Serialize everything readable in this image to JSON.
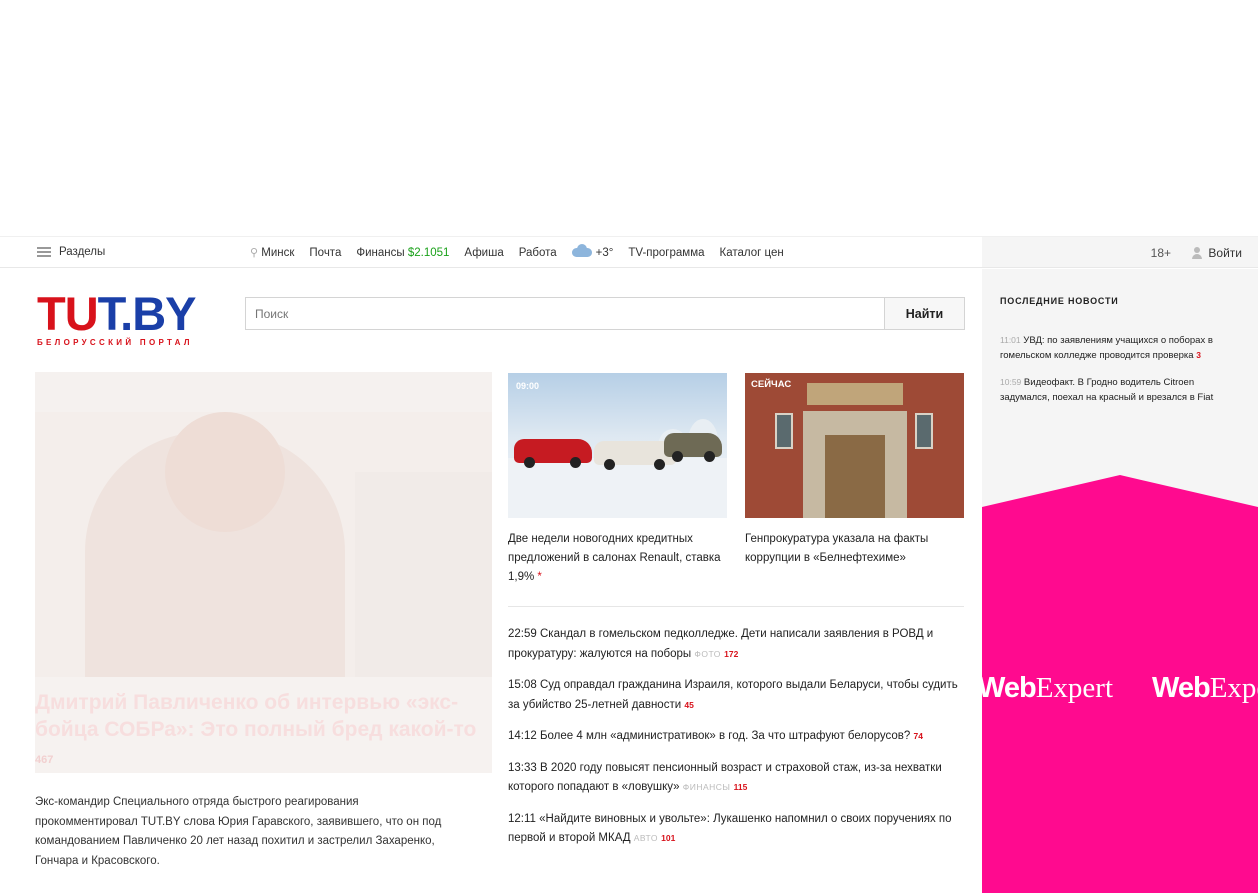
{
  "topnav": {
    "sections_label": "Разделы",
    "city": "Минск",
    "mail": "Почта",
    "finance_label": "Финансы",
    "finance_value": "$2.1051",
    "afisha": "Афиша",
    "jobs": "Работа",
    "weather": "+3°",
    "tv": "TV-программа",
    "catalog": "Каталог цен",
    "age": "18+",
    "login": "Войти"
  },
  "logo": {
    "part1": "T",
    "part2": "U",
    "part3": "T.BY",
    "tagline": "БЕЛОРУССКИЙ ПОРТАЛ"
  },
  "search": {
    "placeholder": "Поиск",
    "button": "Найти"
  },
  "main_story": {
    "title": "Дмитрий Павличенко об интервью «экс-бойца СОБРа»: Это полный бред какой-то",
    "count": "467",
    "lead": "Экс-командир Специального отряда быстрого реагирования прокомментировал TUT.BY слова Юрия Гаравского, заявившего, что он под командованием Павличенко 20 лет назад похитил и застрелил Захаренко, Гончара и Красовского."
  },
  "cards": [
    {
      "badge": "09:00",
      "caption": "Две недели новогодних кредитных предложений в салонах Renault, ставка 1,9%",
      "mark": "*"
    },
    {
      "badge": "СЕЙЧАС",
      "caption": "Генпрокуратура указала на факты коррупции в «Белнефтехиме»"
    }
  ],
  "news": [
    {
      "time": "22:59",
      "text": "Скандал в гомельском педколледже. Дети написали заявления в РОВД и прокуратуру: жалуются на поборы",
      "tag": "ФОТО",
      "count": "172"
    },
    {
      "time": "15:08",
      "text": "Суд оправдал гражданина Израиля, которого выдали Беларуси, чтобы судить за убийство 25-летней давности",
      "tag": "",
      "count": "45"
    },
    {
      "time": "14:12",
      "text": "Более 4 млн «административок» в год. За что штрафуют белорусов?",
      "tag": "",
      "count": "74"
    },
    {
      "time": "13:33",
      "text": "В 2020 году повысят пенсионный возраст и страховой стаж, из-за нехватки которого попадают в «ловушку»",
      "tag": "ФИНАНСЫ",
      "count": "115"
    },
    {
      "time": "12:11",
      "text": "«Найдите виновных и увольте»: Лукашенко напомнил о своих поручениях по первой и второй МКАД",
      "tag": "АВТО",
      "count": "101"
    }
  ],
  "latest": {
    "heading": "ПОСЛЕДНИЕ НОВОСТИ",
    "items": [
      {
        "time": "11:01",
        "text": "УВД: по заявлениям учащихся о поборах в гомельском колледже проводится проверка",
        "count": "3"
      },
      {
        "time": "10:59",
        "text": "Видеофакт. В Гродно водитель Citroen задумался, поехал на красный и врезался в Fiat",
        "count": ""
      }
    ]
  },
  "ad": {
    "brand1_bold": "Web",
    "brand1_rest": "Expert",
    "brand2_bold": "Web",
    "brand2_rest": "Expe",
    "color": "#ff0a8f"
  }
}
